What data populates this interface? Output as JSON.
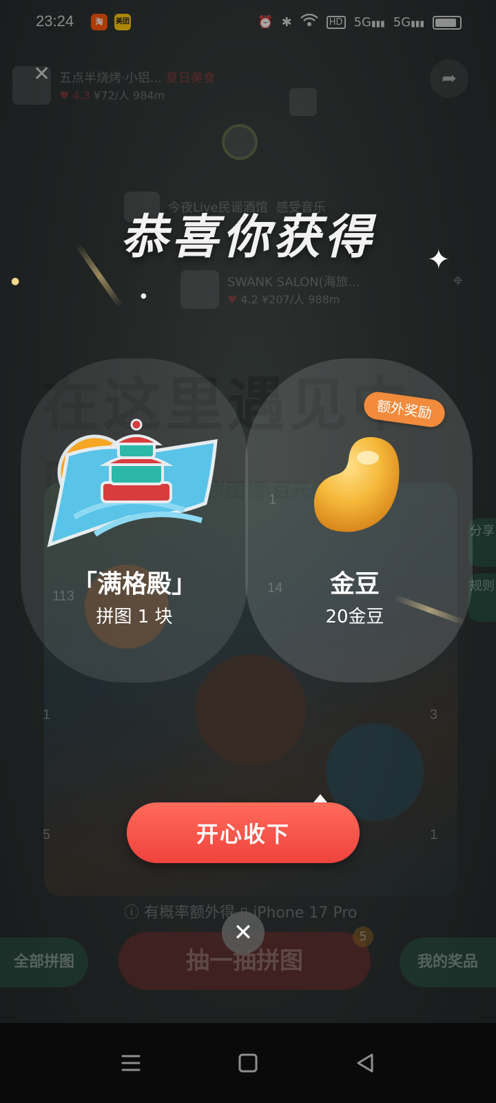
{
  "status_bar": {
    "time": "23:24",
    "app_badges": [
      {
        "label": "淘",
        "color": "#ff5000"
      },
      {
        "label": "美团",
        "color": "#ffc300"
      }
    ],
    "icons": [
      "alarm-icon",
      "bluetooth-icon",
      "wifi-icon",
      "hd-icon",
      "signal-5g-icon",
      "signal-5g-icon",
      "battery-icon"
    ],
    "hd_label": "HD",
    "signal_label": "5G"
  },
  "background_app": {
    "place1": {
      "name": "五点半烧烤·小铝...",
      "tag": "夏日美食",
      "rating": "4.3",
      "price": "¥72/人",
      "distance": "984m"
    },
    "place2": {
      "name": "今夜Live民谣酒馆",
      "tag": "感受音乐"
    },
    "place3": {
      "name": "SWANK SALON(海旅...",
      "rating": "4.2",
      "price": "¥207/人",
      "distance": "988m"
    },
    "banner_title": "在这里遇见中国美",
    "banner_subtitle": "拼图领\\百元优惠",
    "map_numbers": [
      "1",
      "113",
      "14",
      "1",
      "3",
      "5",
      "1"
    ],
    "side_share": "分享",
    "side_rules": "规则",
    "hint_text": "有概率额外得",
    "hint_prize": "iPhone 17 Pro",
    "all_puzzles": "全部拼图",
    "draw_button": "抽一抽拼图",
    "draw_badge": "5",
    "my_prizes": "我的奖品"
  },
  "dialog": {
    "title": "恭喜你获得",
    "rewards": [
      {
        "name": "「满格殿」",
        "description": "拼图 1 块",
        "icon": "temple-puzzle-icon"
      },
      {
        "name": "金豆",
        "description": "20金豆",
        "icon": "gold-bean-icon",
        "extra_tag": "额外奖励"
      }
    ],
    "accept_button": "开心收下",
    "close_icon": "close-icon"
  },
  "nav_bar": {
    "icons": [
      "menu-icon",
      "home-icon",
      "back-icon"
    ]
  },
  "colors": {
    "accent_red": "#f0433e",
    "tag_orange": "#f28b3c",
    "gold": "#f5b93a"
  }
}
